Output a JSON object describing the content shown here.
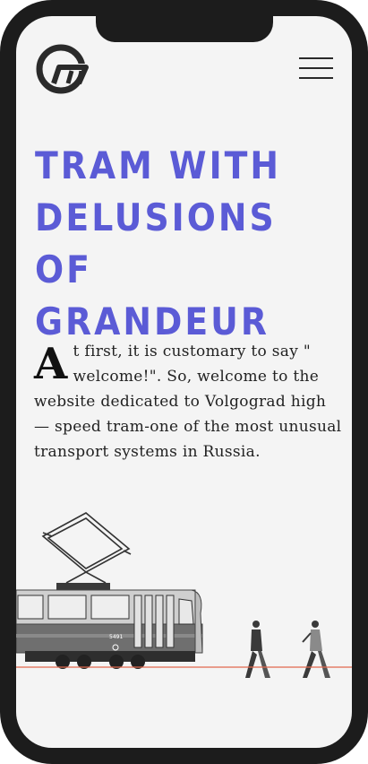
{
  "header": {
    "logo_icon": "brand-logo-icon",
    "menu_icon": "hamburger-menu-icon"
  },
  "hero": {
    "title_lines": [
      "TRAM WITH",
      "DELUSIONS OF",
      "GRANDEUR"
    ]
  },
  "intro": {
    "drop_cap": "A",
    "text": "t first, it is customary to say \" welcome!\". So, welcome to the website dedicated to Volgograd high — speed tram-one of the most unusual transport systems in Russia."
  },
  "illustration": {
    "tram_number": "5491",
    "ground_line_color": "#e0684e"
  },
  "colors": {
    "accent": "#5b5bd6",
    "frame": "#1c1c1c",
    "screen": "#f4f4f4"
  }
}
